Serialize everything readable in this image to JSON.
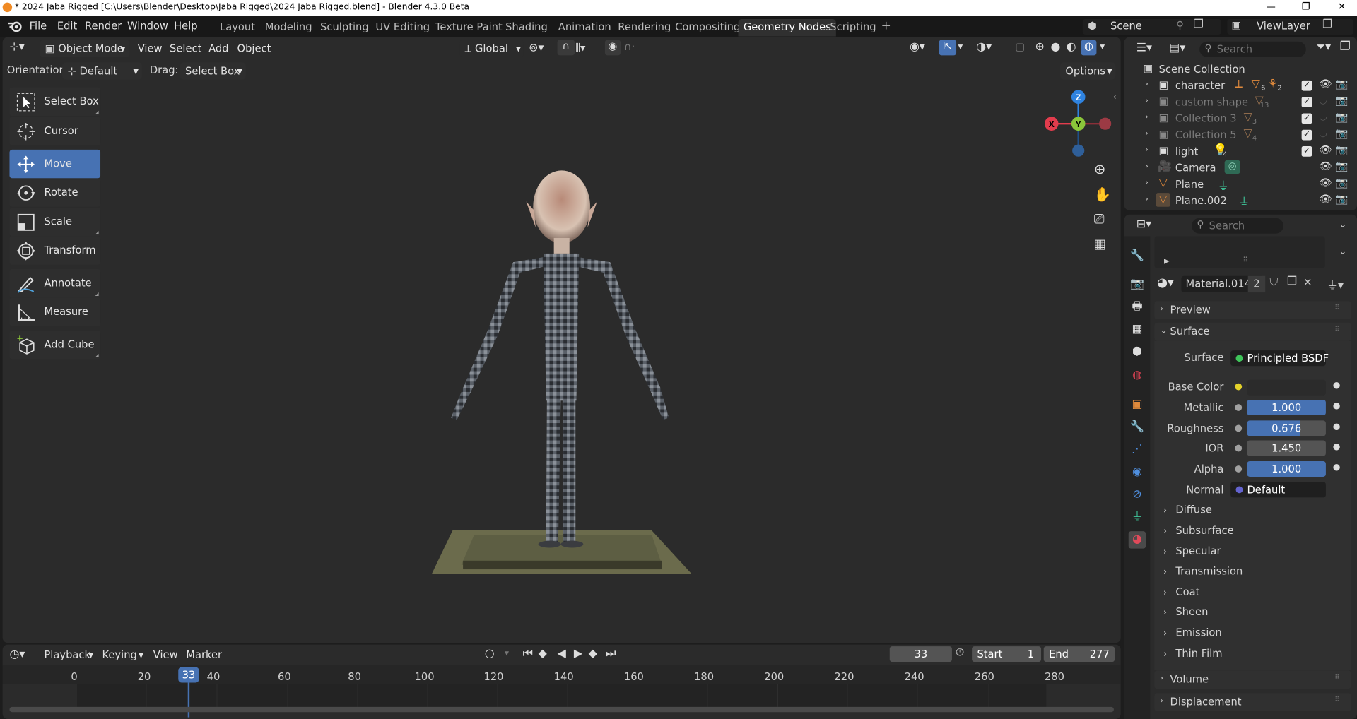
{
  "title_bar": {
    "text": "* 2024 Jaba Rigged [C:\\Users\\Blender\\Desktop\\Jaba Rigged\\2024 Jaba Rigged.blend] - Blender 4.3.0 Beta",
    "minimize": "—",
    "restore": "❐",
    "close": "✕"
  },
  "menus": [
    "File",
    "Edit",
    "Render",
    "Window",
    "Help"
  ],
  "workspaces": [
    "Layout",
    "Modeling",
    "Sculpting",
    "UV Editing",
    "Texture Paint",
    "Shading",
    "Animation",
    "Rendering",
    "Compositing",
    "Geometry Nodes",
    "Scripting"
  ],
  "workspace_add": "+",
  "scene": {
    "name": "Scene",
    "view_layer": "ViewLayer"
  },
  "viewport": {
    "mode": "Object Mode",
    "menus": [
      "View",
      "Select",
      "Add",
      "Object"
    ],
    "transform_orientation": "Global",
    "orientation_label": "Orientation:",
    "orientation_value": "Default",
    "drag_label": "Drag:",
    "drag_value": "Select Box",
    "options": "Options",
    "gizmo_axes": {
      "x": "X",
      "y": "Y",
      "z": "Z"
    }
  },
  "tools": [
    "Select Box",
    "Cursor",
    "Move",
    "Rotate",
    "Scale",
    "Transform",
    "Annotate",
    "Measure",
    "Add Cube"
  ],
  "active_tool": "Move",
  "outliner": {
    "search_placeholder": "Search",
    "root": "Scene Collection",
    "items": [
      {
        "name": "character",
        "dim": false,
        "badge1": "6",
        "badge2": "2"
      },
      {
        "name": "custom shape",
        "dim": true,
        "badge1": "13"
      },
      {
        "name": "Collection 3",
        "dim": true,
        "badge1": "3"
      },
      {
        "name": "Collection 5",
        "dim": true,
        "badge1": "4"
      },
      {
        "name": "light",
        "dim": false,
        "badge1": "4"
      },
      {
        "name": "Camera",
        "dim": false
      },
      {
        "name": "Plane",
        "dim": false
      },
      {
        "name": "Plane.002",
        "dim": false
      }
    ]
  },
  "properties": {
    "search_placeholder": "Search",
    "material_name": "Material.014",
    "material_users": "2",
    "panels": {
      "preview": "Preview",
      "surface": "Surface",
      "volume": "Volume",
      "displacement": "Displacement"
    },
    "surface_label": "Surface",
    "surface_shader": "Principled BSDF",
    "inputs": {
      "base_color_label": "Base Color",
      "metallic_label": "Metallic",
      "metallic": "1.000",
      "roughness_label": "Roughness",
      "roughness": "0.676",
      "ior_label": "IOR",
      "ior": "1.450",
      "alpha_label": "Alpha",
      "alpha": "1.000",
      "normal_label": "Normal",
      "normal": "Default"
    },
    "subpanels": [
      "Diffuse",
      "Subsurface",
      "Specular",
      "Transmission",
      "Coat",
      "Sheen",
      "Emission",
      "Thin Film"
    ]
  },
  "timeline": {
    "menus": [
      "Playback",
      "Keying",
      "View",
      "Marker"
    ],
    "current_frame": "33",
    "start_label": "Start",
    "start": "1",
    "end_label": "End",
    "end": "277",
    "ticks": [
      "0",
      "20",
      "40",
      "60",
      "80",
      "100",
      "120",
      "140",
      "160",
      "180",
      "200",
      "220",
      "240",
      "260",
      "280"
    ]
  },
  "colors": {
    "accent": "#4772b3",
    "bg": "#2b2b2b",
    "x_axis": "#e33c4d",
    "y_axis": "#8bc63a",
    "z_axis": "#2f83e0",
    "collection_orange": "#e08a3c"
  }
}
